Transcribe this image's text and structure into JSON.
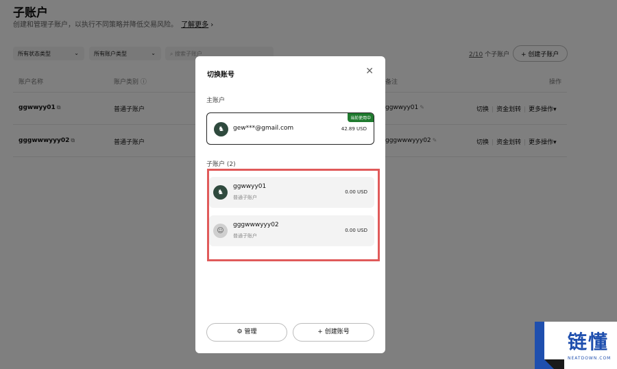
{
  "page": {
    "title": "子账户",
    "subtitle": "创建和管理子账户，以执行不同策略并降低交易风险。",
    "learn_more": "了解更多"
  },
  "filters": {
    "status": "所有状态类型",
    "type": "所有账户类型",
    "search_placeholder": "搜索子账户"
  },
  "count": {
    "value": "2/10",
    "suffix": "个子账户"
  },
  "create_sub": "创建子账户",
  "table": {
    "headers": [
      "账户名称",
      "账户类别",
      "备注",
      "操作"
    ],
    "rows": [
      {
        "name": "ggwwyy01",
        "type": "普通子账户",
        "note": "ggwwyy01",
        "op1": "切换",
        "op2": "资金划转",
        "op3": "更多操作"
      },
      {
        "name": "gggwwwyyy02",
        "type": "普通子账户",
        "note": "gggwwwyyy02",
        "op1": "切换",
        "op2": "资金划转",
        "op3": "更多操作"
      }
    ]
  },
  "modal": {
    "title": "切换账号",
    "main_label": "主账户",
    "main_account": {
      "email": "gew***@gmail.com",
      "balance": "42.89 USD",
      "badge": "当前使用中"
    },
    "sub_label": "子账户 (2)",
    "sub_accounts": [
      {
        "name": "ggwwyy01",
        "type": "普通子账户",
        "balance": "0.00 USD"
      },
      {
        "name": "gggwwwyyy02",
        "type": "普通子账户",
        "balance": "0.00 USD"
      }
    ],
    "manage": "管理",
    "create_account": "创建账号"
  },
  "watermark": {
    "text": "链懂",
    "sub": "NEATDOWN.COM"
  },
  "colors": {
    "highlight": "#e05a5a",
    "badge": "#1f7a2e",
    "watermark": "#1f4fae"
  }
}
